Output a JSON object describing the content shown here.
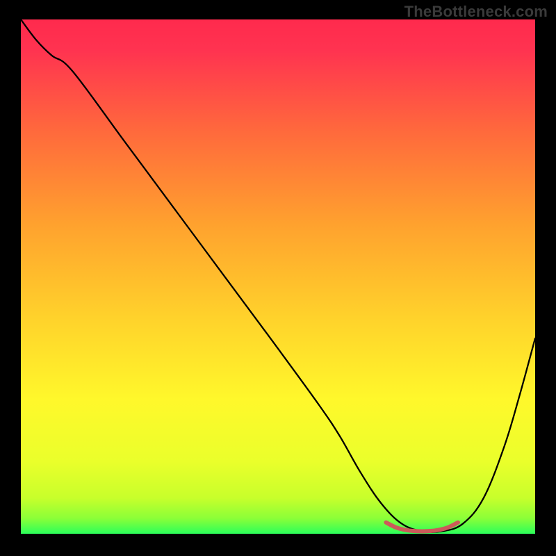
{
  "watermark": "TheBottleneck.com",
  "chart_data": {
    "type": "line",
    "title": "",
    "xlabel": "",
    "ylabel": "",
    "xlim": [
      0,
      100
    ],
    "ylim": [
      0,
      100
    ],
    "grid": false,
    "background_gradient": {
      "top": "#ff2a4d",
      "upper_mid": "#ff8a2b",
      "mid": "#ffd22b",
      "lower_mid": "#f7ff2b",
      "near_bottom": "#bfff2b",
      "bottom": "#2bff5a"
    },
    "series": [
      {
        "name": "bottleneck-curve-black",
        "color": "#000000",
        "x": [
          0,
          3,
          6,
          10,
          20,
          30,
          40,
          50,
          58,
          62,
          66,
          70,
          74,
          78,
          82,
          86,
          90,
          94,
          97,
          100
        ],
        "y": [
          100,
          96,
          93,
          90,
          76.5,
          63,
          49.5,
          36,
          25,
          19,
          12,
          6,
          2,
          0.5,
          0.5,
          2,
          7,
          17,
          27,
          38
        ]
      },
      {
        "name": "bottleneck-valley-marker-red",
        "color": "#cc5a5a",
        "x": [
          71,
          73,
          75,
          77,
          79,
          81,
          83,
          85
        ],
        "y": [
          2.2,
          1.2,
          0.7,
          0.5,
          0.5,
          0.7,
          1.2,
          2.2
        ]
      }
    ],
    "notes": "x-axis and y-axis are unlabeled; values are normalized percentages estimated from the plot. The black curve descends from top-left with a slight initial kink, reaches a broad minimum around x≈76–82, then rises toward the right edge. A short salmon/red segment highlights the valley region."
  }
}
